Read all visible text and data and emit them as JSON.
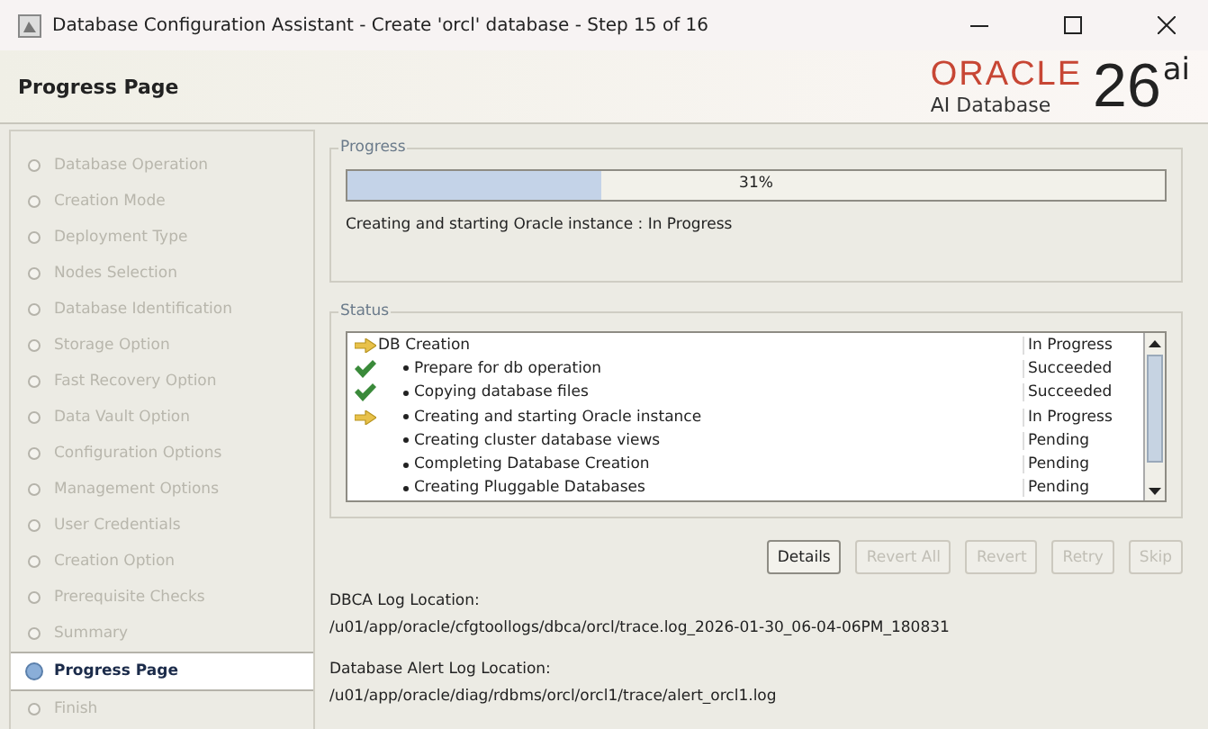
{
  "window": {
    "title": "Database Configuration Assistant - Create 'orcl' database - Step 15 of 16"
  },
  "header": {
    "title": "Progress Page",
    "logo": {
      "brand": "ORACLE",
      "product": "AI Database",
      "version": "26",
      "suffix": "ai"
    }
  },
  "sidebar": {
    "items": [
      {
        "label": "Database Operation",
        "selected": false
      },
      {
        "label": "Creation Mode",
        "selected": false
      },
      {
        "label": "Deployment Type",
        "selected": false
      },
      {
        "label": "Nodes Selection",
        "selected": false
      },
      {
        "label": "Database Identification",
        "selected": false
      },
      {
        "label": "Storage Option",
        "selected": false
      },
      {
        "label": "Fast Recovery Option",
        "selected": false
      },
      {
        "label": "Data Vault Option",
        "selected": false
      },
      {
        "label": "Configuration Options",
        "selected": false
      },
      {
        "label": "Management Options",
        "selected": false
      },
      {
        "label": "User Credentials",
        "selected": false
      },
      {
        "label": "Creation Option",
        "selected": false
      },
      {
        "label": "Prerequisite Checks",
        "selected": false
      },
      {
        "label": "Summary",
        "selected": false
      },
      {
        "label": "Progress Page",
        "selected": true
      },
      {
        "label": "Finish",
        "selected": false
      }
    ]
  },
  "progress": {
    "title": "Progress",
    "level": 0.31,
    "reading": "31%",
    "message": "Creating and starting Oracle instance : In Progress"
  },
  "status": {
    "title": "Status",
    "rows": [
      {
        "name": "DB Creation",
        "status": "In Progress",
        "kind": "running",
        "children": [
          {
            "name": "Prepare for db operation",
            "status": "Succeeded",
            "kind": "done"
          },
          {
            "name": "Copying database files",
            "status": "Succeeded",
            "kind": "done"
          },
          {
            "name": "Creating and starting Oracle instance",
            "status": "In Progress",
            "kind": "running"
          },
          {
            "name": "Creating cluster database views",
            "status": "Pending",
            "kind": "pending"
          },
          {
            "name": "Completing Database Creation",
            "status": "Pending",
            "kind": "pending"
          },
          {
            "name": "Creating Pluggable Databases",
            "status": "Pending",
            "kind": "pending"
          }
        ]
      }
    ]
  },
  "buttons": [
    {
      "label": "Details",
      "disabled": false
    },
    {
      "label": "Revert All",
      "disabled": true
    },
    {
      "label": "Revert",
      "disabled": true
    },
    {
      "label": "Retry",
      "disabled": true
    },
    {
      "label": "Skip",
      "disabled": true
    }
  ],
  "logs": [
    {
      "label": "DBCA Log Location:",
      "path": "/u01/app/oracle/cfgtoollogs/dbca/orcl/trace.log_2026-01-30_06-04-06PM_180831"
    },
    {
      "label": "Database Alert Log Location:",
      "path": "/u01/app/oracle/diag/rdbms/orcl/orcl1/trace/alert_orcl1.log"
    }
  ]
}
